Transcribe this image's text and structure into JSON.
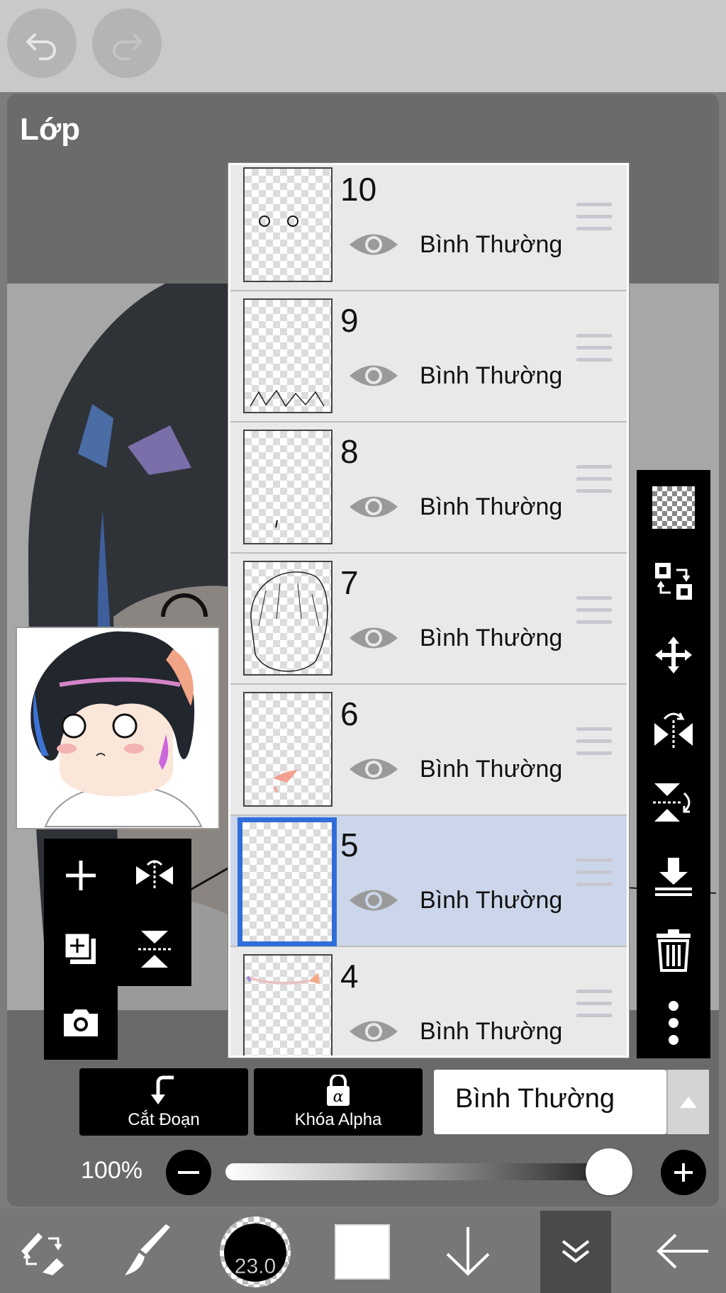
{
  "app": {
    "panel_title": "Lớp"
  },
  "icons": {
    "undo": "undo-icon",
    "redo": "redo-icon",
    "eye": "eye-icon",
    "drag": "drag-handle-icon"
  },
  "layers": [
    {
      "number": "10",
      "blend": "Bình Thường",
      "visible": true,
      "selected": false
    },
    {
      "number": "9",
      "blend": "Bình Thường",
      "visible": true,
      "selected": false
    },
    {
      "number": "8",
      "blend": "Bình Thường",
      "visible": true,
      "selected": false
    },
    {
      "number": "7",
      "blend": "Bình Thường",
      "visible": true,
      "selected": false
    },
    {
      "number": "6",
      "blend": "Bình Thường",
      "visible": true,
      "selected": false
    },
    {
      "number": "5",
      "blend": "Bình Thường",
      "visible": true,
      "selected": true
    },
    {
      "number": "4",
      "blend": "Bình Thường",
      "visible": true,
      "selected": false
    }
  ],
  "actions": {
    "clipping_label": "Cắt Đoạn",
    "alpha_lock_label": "Khóa Alpha",
    "blend_mode_value": "Bình Thường"
  },
  "opacity": {
    "label": "100%",
    "value_percent": 100
  },
  "bottom_toolbar": {
    "brush_size": "23.0"
  },
  "colors": {
    "accent_selected": "#2f6ed8",
    "selected_row": "#ccd6ea",
    "toolbar_bg": "#000000"
  }
}
